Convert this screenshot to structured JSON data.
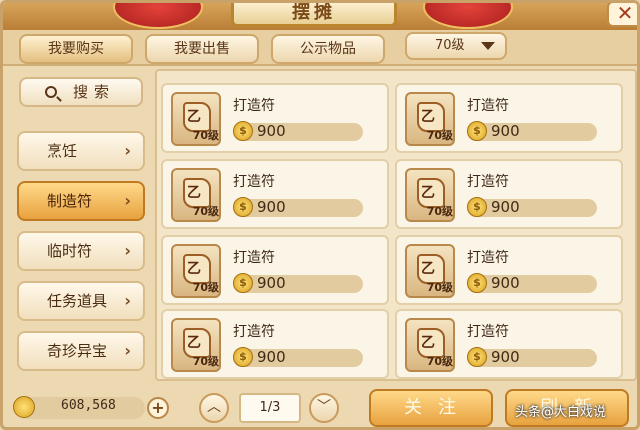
{
  "window": {
    "title": "摆摊",
    "close": "✕"
  },
  "tabs": [
    {
      "label": "我要购买"
    },
    {
      "label": "我要出售"
    },
    {
      "label": "公示物品"
    }
  ],
  "level_filter": {
    "value": "70级"
  },
  "sidebar": {
    "search_label": "搜索",
    "categories": [
      {
        "label": "烹饪"
      },
      {
        "label": "制造符"
      },
      {
        "label": "临时符"
      },
      {
        "label": "任务道具"
      },
      {
        "label": "奇珍异宝"
      }
    ]
  },
  "items": [
    {
      "name": "打造符",
      "level": "70级",
      "price": "900"
    },
    {
      "name": "打造符",
      "level": "70级",
      "price": "900"
    },
    {
      "name": "打造符",
      "level": "70级",
      "price": "900"
    },
    {
      "name": "打造符",
      "level": "70级",
      "price": "900"
    },
    {
      "name": "打造符",
      "level": "70级",
      "price": "900"
    },
    {
      "name": "打造符",
      "level": "70级",
      "price": "900"
    },
    {
      "name": "打造符",
      "level": "70级",
      "price": "900"
    },
    {
      "name": "打造符",
      "level": "70级",
      "price": "900"
    }
  ],
  "footer": {
    "money": "608,568",
    "page": "1/3",
    "follow_label": "关注",
    "refresh_label": "刷新"
  },
  "watermark": "头条@大白戏说",
  "icons": {
    "item": "scroll-icon",
    "coin": "coin-icon",
    "search": "search-icon"
  }
}
